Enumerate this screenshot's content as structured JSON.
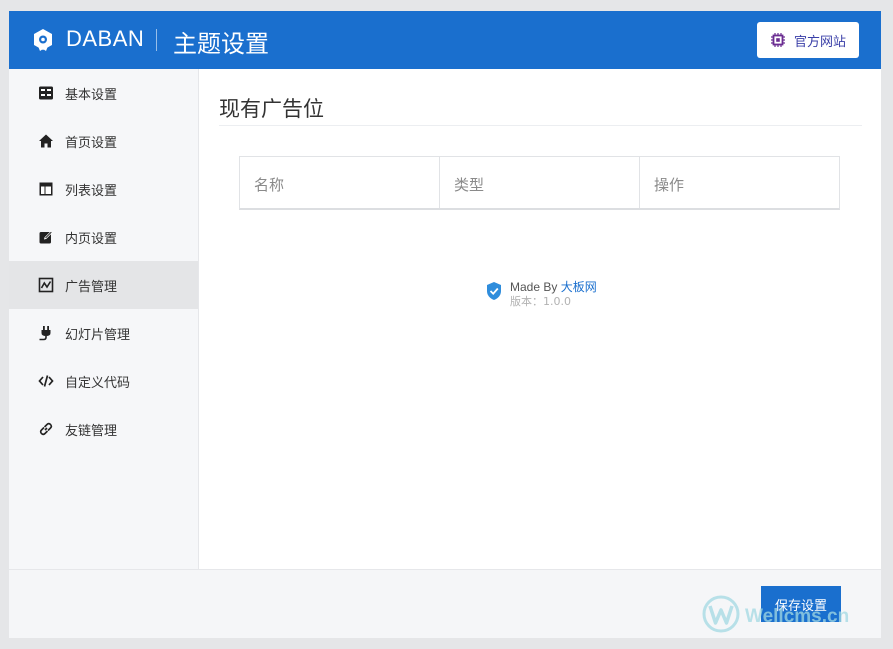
{
  "header": {
    "brand": "DABAN",
    "title": "主题设置",
    "official_button": "官方网站",
    "colors": {
      "bar": "#1a6fce",
      "button_text": "#3a3fa8"
    }
  },
  "sidebar": {
    "active_index": 4,
    "items": [
      {
        "label": "基本设置",
        "icon": "settings-panel-icon"
      },
      {
        "label": "首页设置",
        "icon": "home-icon"
      },
      {
        "label": "列表设置",
        "icon": "layout-icon"
      },
      {
        "label": "内页设置",
        "icon": "edit-icon"
      },
      {
        "label": "广告管理",
        "icon": "chart-icon"
      },
      {
        "label": "幻灯片管理",
        "icon": "plug-icon"
      },
      {
        "label": "自定义代码",
        "icon": "code-icon"
      },
      {
        "label": "友链管理",
        "icon": "link-icon"
      }
    ]
  },
  "main": {
    "section_title": "现有广告位",
    "table": {
      "columns": [
        "名称",
        "类型",
        "操作"
      ],
      "rows": []
    }
  },
  "credit": {
    "made_by": "Made By",
    "site": "大板网",
    "version_label": "版本：",
    "version": "1.0.0"
  },
  "footer": {
    "save_button": "保存设置",
    "watermark": "Wellcms.cn"
  }
}
